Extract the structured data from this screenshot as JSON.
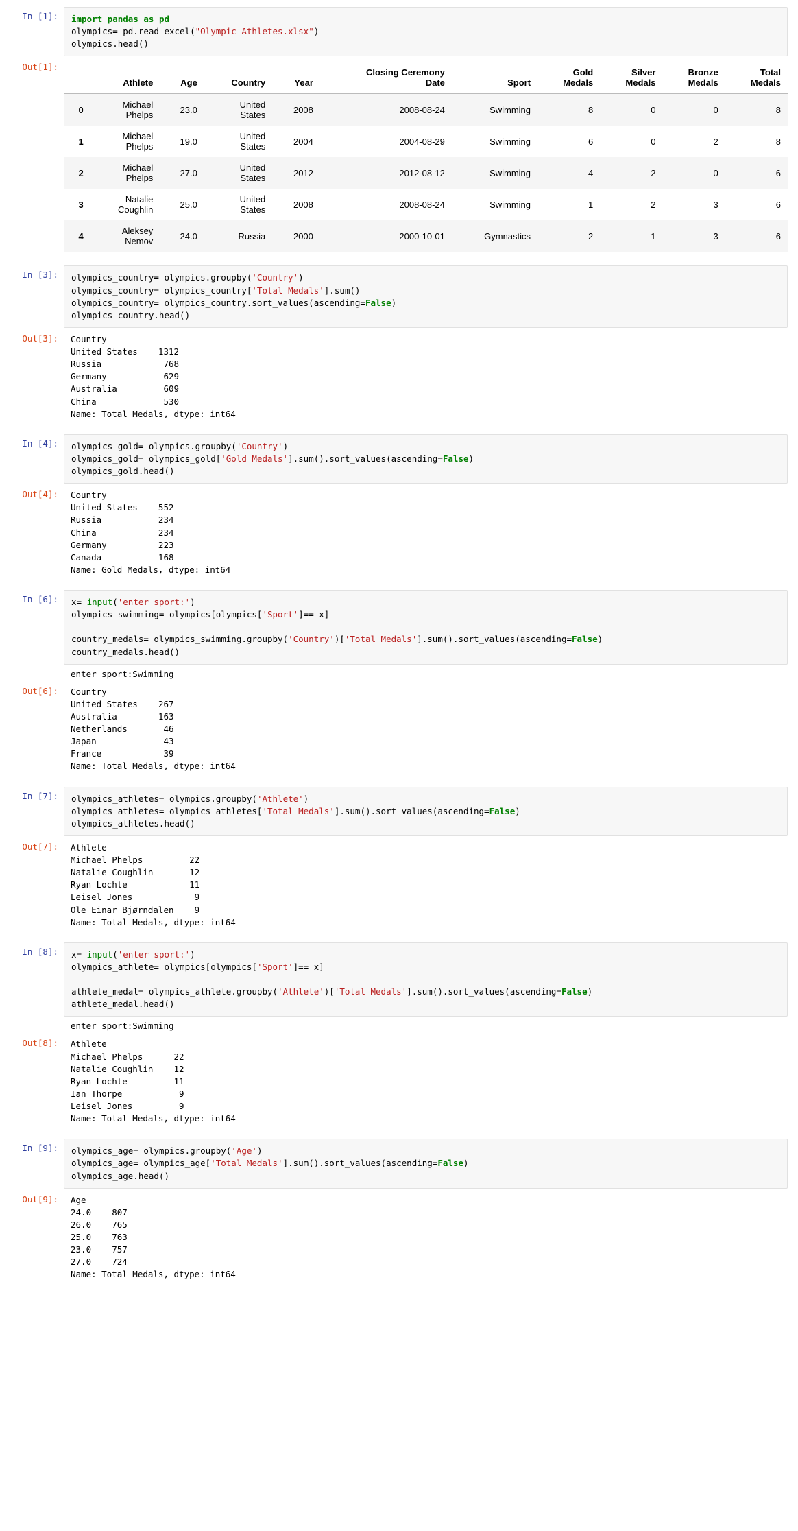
{
  "cells": [
    {
      "type": "code",
      "prompt": "In [1]:",
      "code_html": "<span class='kw-import'>import</span> <span class='kw-bold'>pandas</span> <span class='kw-bold'>as</span> <span class='kw-bold'>pd</span>\nolympics= pd.read_excel(<span class='str'>\"Olympic Athletes.xlsx\"</span>)\nolympics.head()"
    },
    {
      "type": "dataframe",
      "prompt": "Out[1]:",
      "columns": [
        "",
        "Athlete",
        "Age",
        "Country",
        "Year",
        "Closing Ceremony Date",
        "Sport",
        "Gold Medals",
        "Silver Medals",
        "Bronze Medals",
        "Total Medals"
      ],
      "rows": [
        [
          "0",
          "Michael Phelps",
          "23.0",
          "United States",
          "2008",
          "2008-08-24",
          "Swimming",
          "8",
          "0",
          "0",
          "8"
        ],
        [
          "1",
          "Michael Phelps",
          "19.0",
          "United States",
          "2004",
          "2004-08-29",
          "Swimming",
          "6",
          "0",
          "2",
          "8"
        ],
        [
          "2",
          "Michael Phelps",
          "27.0",
          "United States",
          "2012",
          "2012-08-12",
          "Swimming",
          "4",
          "2",
          "0",
          "6"
        ],
        [
          "3",
          "Natalie Coughlin",
          "25.0",
          "United States",
          "2008",
          "2008-08-24",
          "Swimming",
          "1",
          "2",
          "3",
          "6"
        ],
        [
          "4",
          "Aleksey Nemov",
          "24.0",
          "Russia",
          "2000",
          "2000-10-01",
          "Gymnastics",
          "2",
          "1",
          "3",
          "6"
        ]
      ]
    },
    {
      "type": "code",
      "prompt": "In [3]:",
      "code_html": "olympics_country= olympics.groupby(<span class='str'>'Country'</span>)\nolympics_country= olympics_country[<span class='str'>'Total Medals'</span>].sum()\nolympics_country= olympics_country.sort_values(ascending=<span class='kw-bold'>False</span>)\nolympics_country.head()"
    },
    {
      "type": "output",
      "prompt": "Out[3]:",
      "text": "Country\nUnited States    1312\nRussia            768\nGermany           629\nAustralia         609\nChina             530\nName: Total Medals, dtype: int64"
    },
    {
      "type": "code",
      "prompt": "In [4]:",
      "code_html": "olympics_gold= olympics.groupby(<span class='str'>'Country'</span>)\nolympics_gold= olympics_gold[<span class='str'>'Gold Medals'</span>].sum().sort_values(ascending=<span class='kw-bold'>False</span>)\nolympics_gold.head()"
    },
    {
      "type": "output",
      "prompt": "Out[4]:",
      "text": "Country\nUnited States    552\nRussia           234\nChina            234\nGermany          223\nCanada           168\nName: Gold Medals, dtype: int64"
    },
    {
      "type": "code",
      "prompt": "In [6]:",
      "code_html": "x= <span class='builtin'>input</span>(<span class='str'>'enter sport:'</span>)\nolympics_swimming= olympics[olympics[<span class='str'>'Sport'</span>]== x]\n\ncountry_medals= olympics_swimming.groupby(<span class='str'>'Country'</span>)[<span class='str'>'Total Medals'</span>].sum().sort_values(ascending=<span class='kw-bold'>False</span>)\ncountry_medals.head()"
    },
    {
      "type": "stream",
      "prompt": "",
      "text": "enter sport:Swimming"
    },
    {
      "type": "output",
      "prompt": "Out[6]:",
      "text": "Country\nUnited States    267\nAustralia        163\nNetherlands       46\nJapan             43\nFrance            39\nName: Total Medals, dtype: int64"
    },
    {
      "type": "code",
      "prompt": "In [7]:",
      "code_html": "olympics_athletes= olympics.groupby(<span class='str'>'Athlete'</span>)\nolympics_athletes= olympics_athletes[<span class='str'>'Total Medals'</span>].sum().sort_values(ascending=<span class='kw-bold'>False</span>)\nolympics_athletes.head()"
    },
    {
      "type": "output",
      "prompt": "Out[7]:",
      "text": "Athlete\nMichael Phelps         22\nNatalie Coughlin       12\nRyan Lochte            11\nLeisel Jones            9\nOle Einar Bjørndalen    9\nName: Total Medals, dtype: int64"
    },
    {
      "type": "code",
      "prompt": "In [8]:",
      "code_html": "x= <span class='builtin'>input</span>(<span class='str'>'enter sport:'</span>)\nolympics_athlete= olympics[olympics[<span class='str'>'Sport'</span>]== x]\n\nathlete_medal= olympics_athlete.groupby(<span class='str'>'Athlete'</span>)[<span class='str'>'Total Medals'</span>].sum().sort_values(ascending=<span class='kw-bold'>False</span>)\nathlete_medal.head()"
    },
    {
      "type": "stream",
      "prompt": "",
      "text": "enter sport:Swimming"
    },
    {
      "type": "output",
      "prompt": "Out[8]:",
      "text": "Athlete\nMichael Phelps      22\nNatalie Coughlin    12\nRyan Lochte         11\nIan Thorpe           9\nLeisel Jones         9\nName: Total Medals, dtype: int64"
    },
    {
      "type": "code",
      "prompt": "In [9]:",
      "code_html": "olympics_age= olympics.groupby(<span class='str'>'Age'</span>)\nolympics_age= olympics_age[<span class='str'>'Total Medals'</span>].sum().sort_values(ascending=<span class='kw-bold'>False</span>)\nolympics_age.head()"
    },
    {
      "type": "output",
      "prompt": "Out[9]:",
      "text": "Age\n24.0    807\n26.0    765\n25.0    763\n23.0    757\n27.0    724\nName: Total Medals, dtype: int64"
    }
  ]
}
